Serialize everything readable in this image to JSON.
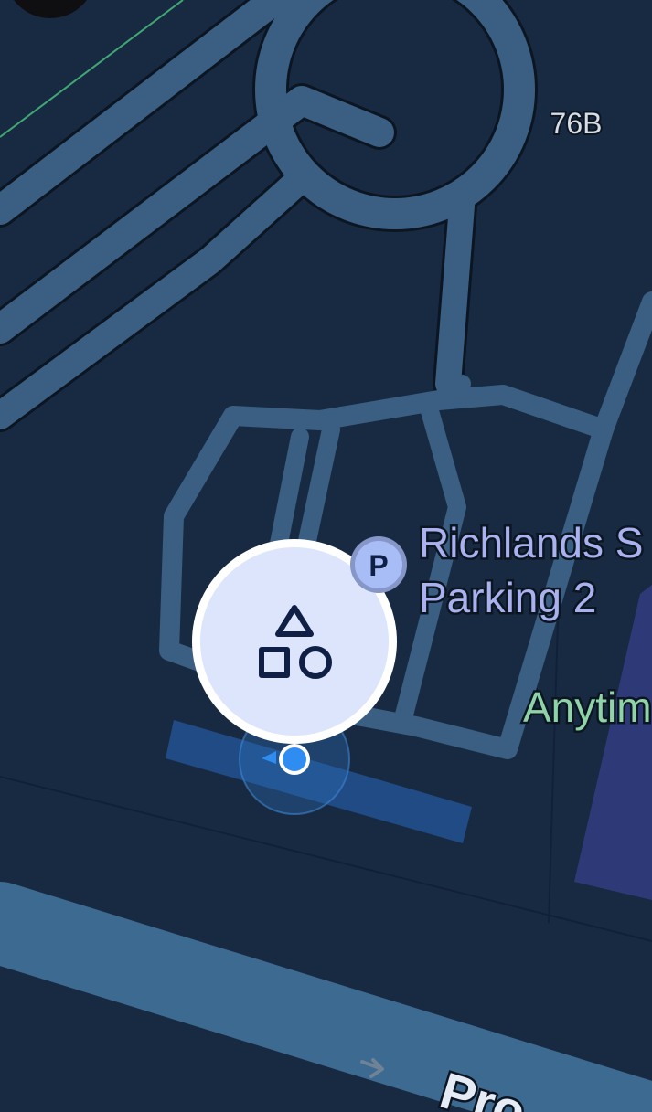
{
  "map": {
    "theme": "dark",
    "colors": {
      "background": "#182a42",
      "road": "#3a5f82",
      "road_outline": "#0c1522",
      "building_area": "#2e3a78",
      "transit_line": "#41a874",
      "poi_text": "#a9b2ee",
      "business_text": "#8fd3a6",
      "parking_badge": "#a8bdf5",
      "location_dot": "#2f8cf0",
      "location_halo": "#2c6fb8",
      "marker_bubble": "#dce5fb",
      "marker_icon": "#0f1f45"
    },
    "labels": {
      "address_number": "76B",
      "parking_name_line1": "Richlands S",
      "parking_name_line2": "Parking 2",
      "business_partial": "Anytim",
      "street_partial": "Pro"
    },
    "icons": {
      "parking": "P",
      "category_marker": "shapes-icon"
    },
    "current_location": {
      "shown": true
    }
  }
}
